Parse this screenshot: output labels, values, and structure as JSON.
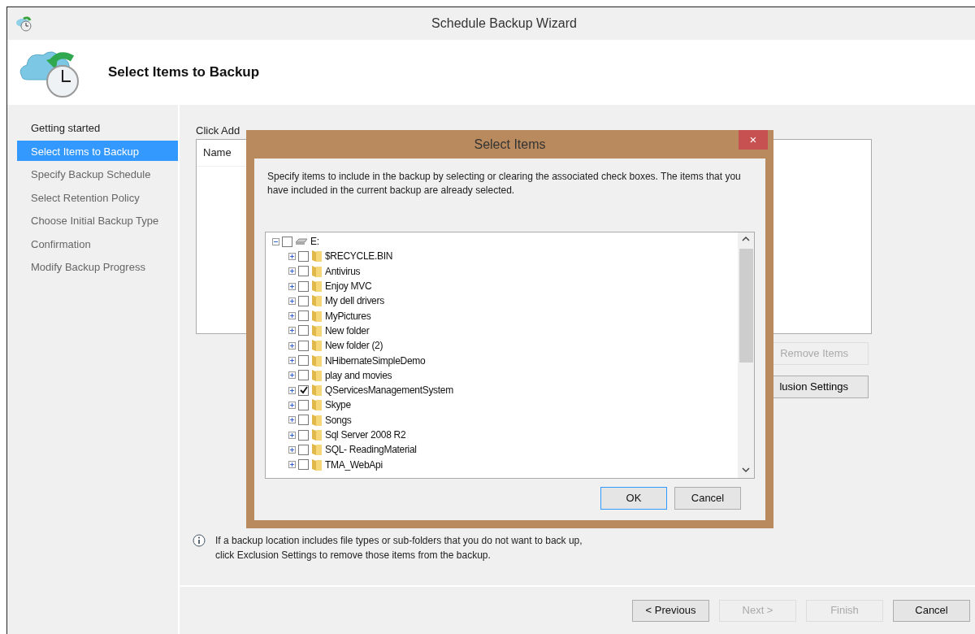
{
  "window": {
    "title": "Schedule Backup Wizard"
  },
  "header": {
    "title": "Select Items to Backup"
  },
  "steps": [
    {
      "label": "Getting started",
      "selected": false
    },
    {
      "label": "Select Items to Backup",
      "selected": true
    },
    {
      "label": "Specify Backup Schedule",
      "selected": false
    },
    {
      "label": "Select Retention Policy",
      "selected": false
    },
    {
      "label": "Choose Initial Backup Type",
      "selected": false
    },
    {
      "label": "Confirmation",
      "selected": false
    },
    {
      "label": "Modify Backup Progress",
      "selected": false
    }
  ],
  "content": {
    "instruction": "Click Add",
    "table": {
      "columns": [
        "Name"
      ]
    },
    "buttons": [
      {
        "label": "Remove Items",
        "disabled": true
      },
      {
        "label": "lusion Settings",
        "disabled": false
      }
    ],
    "info": "If a backup location includes file types or sub-folders that you do not want to back up, click Exclusion Settings to remove those items from the backup."
  },
  "dialog": {
    "title": "Select Items",
    "close": "×",
    "description": "Specify items to include in the backup by selecting or clearing the associated check boxes. The items that you have included in the current backup are already selected.",
    "tree": [
      {
        "label": "E:",
        "kind": "drive",
        "checked": false,
        "expanded": true,
        "children": [
          {
            "label": "$RECYCLE.BIN",
            "kind": "folder",
            "checked": false,
            "expanded": false
          },
          {
            "label": "Antivirus",
            "kind": "folder",
            "checked": false,
            "expanded": false
          },
          {
            "label": "Enjoy MVC",
            "kind": "folder",
            "checked": false,
            "expanded": false
          },
          {
            "label": "My dell drivers",
            "kind": "folder",
            "checked": false,
            "expanded": false
          },
          {
            "label": "MyPictures",
            "kind": "folder",
            "checked": false,
            "expanded": false
          },
          {
            "label": "New folder",
            "kind": "folder",
            "checked": false,
            "expanded": false
          },
          {
            "label": "New folder (2)",
            "kind": "folder",
            "checked": false,
            "expanded": false
          },
          {
            "label": "NHibernateSimpleDemo",
            "kind": "folder",
            "checked": false,
            "expanded": false
          },
          {
            "label": "play and movies",
            "kind": "folder",
            "checked": false,
            "expanded": false
          },
          {
            "label": "QServicesManagementSystem",
            "kind": "folder",
            "checked": true,
            "expanded": false
          },
          {
            "label": "Skype",
            "kind": "folder",
            "checked": false,
            "expanded": false
          },
          {
            "label": "Songs",
            "kind": "folder",
            "checked": false,
            "expanded": false
          },
          {
            "label": "Sql Server 2008 R2",
            "kind": "folder",
            "checked": false,
            "expanded": false
          },
          {
            "label": "SQL- ReadingMaterial",
            "kind": "folder",
            "checked": false,
            "expanded": false
          },
          {
            "label": "TMA_WebApi",
            "kind": "folder",
            "checked": false,
            "expanded": false
          }
        ]
      }
    ],
    "buttons": [
      {
        "label": "OK",
        "default": true
      },
      {
        "label": "Cancel",
        "default": false
      }
    ]
  },
  "footer": {
    "buttons": [
      {
        "label": "< Previous",
        "disabled": false
      },
      {
        "label": "Next >",
        "disabled": true
      },
      {
        "label": "Finish",
        "disabled": true
      },
      {
        "label": "Cancel",
        "disabled": false
      }
    ]
  }
}
